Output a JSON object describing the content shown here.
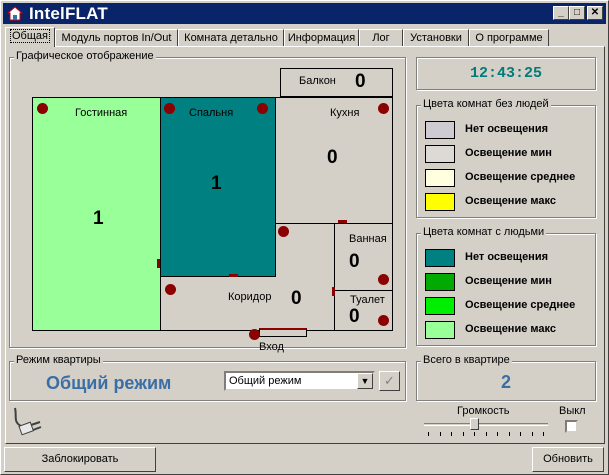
{
  "window": {
    "title": "IntelFLAT"
  },
  "tabs": [
    {
      "label": "Общая"
    },
    {
      "label": "Модуль портов In/Out"
    },
    {
      "label": "Комната детально"
    },
    {
      "label": "Информация"
    },
    {
      "label": "Лог"
    },
    {
      "label": "Установки"
    },
    {
      "label": "О программе"
    }
  ],
  "plan": {
    "group_label": "Графическое отображение",
    "rooms": {
      "living": {
        "name": "Гостинная",
        "count": "1",
        "color": "#99ff99"
      },
      "bedroom": {
        "name": "Спальня",
        "count": "1",
        "color": "#008080"
      },
      "balcony": {
        "name": "Балкон",
        "count": "0",
        "color": "#d4d0c8"
      },
      "kitchen": {
        "name": "Кухня",
        "count": "0",
        "color": "#d4d0c8"
      },
      "bathroom": {
        "name": "Ванная",
        "count": "0",
        "color": "#d4d0c8"
      },
      "corridor": {
        "name": "Коридор",
        "count": "0",
        "color": "#d4d0c8"
      },
      "toilet": {
        "name": "Туалет",
        "count": "0",
        "color": "#d4d0c8"
      }
    },
    "entrance_label": "Вход",
    "sensor_color": "#8b0000"
  },
  "clock": {
    "time": "12:43:25"
  },
  "legend_empty": {
    "title": "Цвета комнат без людей",
    "items": [
      {
        "label": "Нет освещения",
        "color": "#cfcbd2"
      },
      {
        "label": "Освещение мин",
        "color": "#dcdad5"
      },
      {
        "label": "Освещение среднее",
        "color": "#ffffe0"
      },
      {
        "label": "Освещение макс",
        "color": "#ffff00"
      }
    ]
  },
  "legend_occupied": {
    "title": "Цвета комнат с людьми",
    "items": [
      {
        "label": "Нет освещения",
        "color": "#008080"
      },
      {
        "label": "Освещение мин",
        "color": "#00aa00"
      },
      {
        "label": "Освещение среднее",
        "color": "#00ee00"
      },
      {
        "label": "Освещение макс",
        "color": "#99ff99"
      }
    ]
  },
  "mode": {
    "group_label": "Режим квартиры",
    "current": "Общий режим",
    "select_value": "Общий режим",
    "apply_glyph": "✓"
  },
  "total": {
    "label": "Всего в квартире",
    "value": "2"
  },
  "volume": {
    "label": "Громкость",
    "off_label": "Выкл",
    "level": 0.4,
    "muted": false
  },
  "footer": {
    "lock_button": "Заблокировать",
    "refresh_button": "Обновить"
  }
}
